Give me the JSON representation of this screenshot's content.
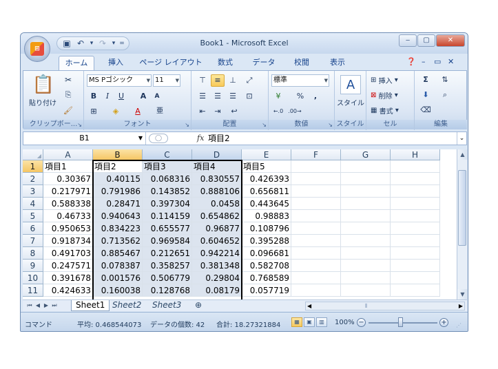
{
  "window": {
    "title": "Book1 - Microsoft Excel",
    "buttons": {
      "minimize": "‒",
      "maximize": "▢",
      "close": "✕"
    }
  },
  "office_button": {
    "label": "⊞"
  },
  "quick_access": {
    "save_icon": "floppy-icon",
    "undo_icon": "undo-icon",
    "redo_icon": "redo-icon"
  },
  "tabs": [
    {
      "label": "ホーム",
      "active": true
    },
    {
      "label": "挿入"
    },
    {
      "label": "ページ レイアウト"
    },
    {
      "label": "数式"
    },
    {
      "label": "データ"
    },
    {
      "label": "校閲"
    },
    {
      "label": "表示"
    }
  ],
  "ribbon": {
    "groups": [
      {
        "label": "クリップボー..."
      },
      {
        "label": "フォント"
      },
      {
        "label": "配置"
      },
      {
        "label": "数値"
      },
      {
        "label": "スタイル"
      },
      {
        "label": "セル"
      },
      {
        "label": "編集"
      }
    ],
    "clipboard": {
      "paste": "貼り付け"
    },
    "font": {
      "name": "MS Pゴシック",
      "size": "11",
      "bold": "B",
      "italic": "I",
      "underline": "U",
      "grow": "A",
      "shrink": "A",
      "font_color": "A",
      "phonetic": "亜"
    },
    "number": {
      "format": "標準",
      "percent": "%",
      "comma": ","
    },
    "style": {
      "label": "スタイル"
    },
    "cells": {
      "insert": "挿入",
      "delete": "削除",
      "format": "書式"
    },
    "editing": {
      "sum": "Σ"
    }
  },
  "formula_bar": {
    "name_box": "B1",
    "fx": "fx",
    "content": "項目2"
  },
  "columns": [
    "A",
    "B",
    "C",
    "D",
    "E",
    "F",
    "G",
    "H"
  ],
  "rows": [
    {
      "n": "1",
      "cells": [
        "項目1",
        "項目2",
        "項目3",
        "項目4",
        "項目5"
      ]
    },
    {
      "n": "2",
      "cells": [
        "0.30367",
        "0.40115",
        "0.068316",
        "0.830557",
        "0.426393"
      ]
    },
    {
      "n": "3",
      "cells": [
        "0.217971",
        "0.791986",
        "0.143852",
        "0.888106",
        "0.656811"
      ]
    },
    {
      "n": "4",
      "cells": [
        "0.588338",
        "0.28471",
        "0.397304",
        "0.0458",
        "0.443645"
      ]
    },
    {
      "n": "5",
      "cells": [
        "0.46733",
        "0.940643",
        "0.114159",
        "0.654862",
        "0.98883"
      ]
    },
    {
      "n": "6",
      "cells": [
        "0.950653",
        "0.834223",
        "0.655577",
        "0.96877",
        "0.108796"
      ]
    },
    {
      "n": "7",
      "cells": [
        "0.918734",
        "0.713562",
        "0.969584",
        "0.604652",
        "0.395288"
      ]
    },
    {
      "n": "8",
      "cells": [
        "0.491703",
        "0.885467",
        "0.212651",
        "0.942214",
        "0.096681"
      ]
    },
    {
      "n": "9",
      "cells": [
        "0.247571",
        "0.078387",
        "0.358257",
        "0.381348",
        "0.582708"
      ]
    },
    {
      "n": "10",
      "cells": [
        "0.391678",
        "0.001576",
        "0.506779",
        "0.29804",
        "0.768589"
      ]
    },
    {
      "n": "11",
      "cells": [
        "0.424633",
        "0.160038",
        "0.128768",
        "0.08179",
        "0.057719"
      ]
    }
  ],
  "sheets": [
    {
      "label": "Sheet1",
      "active": true
    },
    {
      "label": "Sheet2"
    },
    {
      "label": "Sheet3"
    }
  ],
  "status_bar": {
    "mode": "コマンド",
    "average": "平均: 0.468544073",
    "count": "データの個数: 42",
    "sum": "合計: 18.27321884",
    "zoom": "100%"
  },
  "colors": {
    "accent": "#15428b",
    "selection": "#f5c664"
  }
}
